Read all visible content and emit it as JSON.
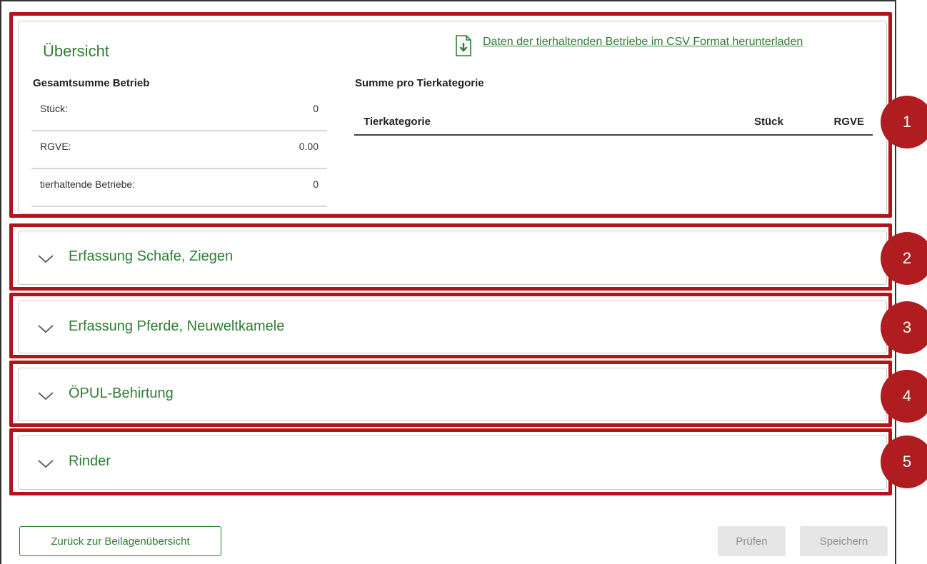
{
  "overview": {
    "title": "Übersicht",
    "download_link": "Daten der tierhaltenden Betriebe im CSV Format herunterladen",
    "totals_heading": "Gesamtsumme Betrieb",
    "totals": [
      {
        "label": "Stück:",
        "value": "0"
      },
      {
        "label": "RGVE:",
        "value": "0.00"
      },
      {
        "label": "tierhaltende Betriebe:",
        "value": "0"
      }
    ],
    "category_heading": "Summe pro Tierkategorie",
    "category_table": {
      "columns": [
        "Tierkategorie",
        "Stück",
        "RGVE"
      ],
      "rows": []
    }
  },
  "accordions": [
    {
      "title": "Erfassung Schafe, Ziegen"
    },
    {
      "title": "Erfassung Pferde, Neuweltkamele"
    },
    {
      "title": "ÖPUL-Behirtung"
    },
    {
      "title": "Rinder"
    }
  ],
  "annotations": [
    "1",
    "2",
    "3",
    "4",
    "5"
  ],
  "footer": {
    "back_label": "Zurück zur Beilagenübersicht",
    "check_label": "Prüfen",
    "save_label": "Speichern"
  },
  "colors": {
    "accent_green": "#2e7d32",
    "highlight_red": "#b3141c",
    "badge_red": "#b01d20"
  }
}
